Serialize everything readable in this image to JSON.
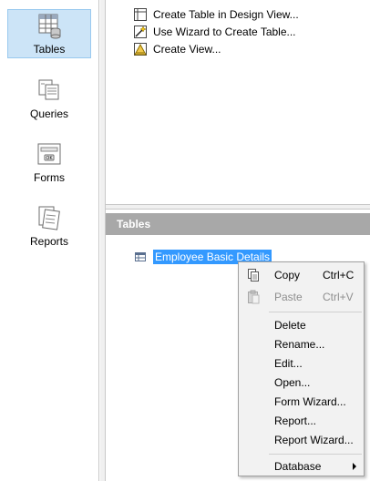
{
  "nav": {
    "items": [
      {
        "label": "Tables",
        "icon": "tables-icon",
        "selected": true
      },
      {
        "label": "Queries",
        "icon": "queries-icon",
        "selected": false
      },
      {
        "label": "Forms",
        "icon": "forms-icon",
        "selected": false
      },
      {
        "label": "Reports",
        "icon": "reports-icon",
        "selected": false
      }
    ]
  },
  "tasks": {
    "items": [
      {
        "label": "Create Table in Design View...",
        "icon": "design-view-icon"
      },
      {
        "label": "Use Wizard to Create Table...",
        "icon": "wizard-icon"
      },
      {
        "label": "Create View...",
        "icon": "view-icon"
      }
    ]
  },
  "tables_pane": {
    "header": "Tables",
    "entries": [
      {
        "label": "Employee Basic Details",
        "icon": "table-icon",
        "selected": true
      }
    ]
  },
  "context_menu": {
    "items": [
      {
        "label": "Copy",
        "shortcut": "Ctrl+C",
        "enabled": true,
        "icon": "copy-icon"
      },
      {
        "label": "Paste",
        "shortcut": "Ctrl+V",
        "enabled": false,
        "icon": "paste-icon"
      },
      {
        "label": "Delete",
        "enabled": true
      },
      {
        "label": "Rename...",
        "enabled": true
      },
      {
        "label": "Edit...",
        "enabled": true
      },
      {
        "label": "Open...",
        "enabled": true
      },
      {
        "label": "Form Wizard...",
        "enabled": true
      },
      {
        "label": "Report...",
        "enabled": true
      },
      {
        "label": "Report Wizard...",
        "enabled": true
      },
      {
        "label": "Database",
        "enabled": true,
        "submenu": true
      }
    ]
  },
  "colors": {
    "selection": "#3399ff",
    "nav_selected_bg": "#cce4f7",
    "header_bg": "#a8a8a8"
  }
}
